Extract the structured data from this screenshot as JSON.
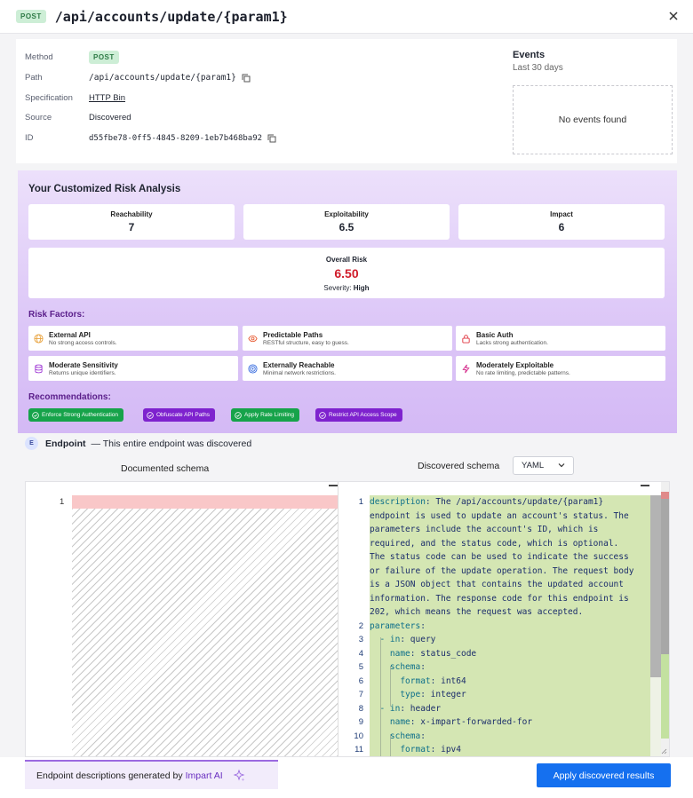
{
  "header": {
    "method_badge": "POST",
    "title": "/api/accounts/update/{param1}"
  },
  "info": {
    "method_label": "Method",
    "method_value": "POST",
    "path_label": "Path",
    "path_value": "/api/accounts/update/{param1}",
    "spec_label": "Specification",
    "spec_value": "HTTP Bin",
    "source_label": "Source",
    "source_value": "Discovered",
    "id_label": "ID",
    "id_value": "d55fbe78-0ff5-4845-8209-1eb7b468ba92"
  },
  "events": {
    "title": "Events",
    "subtitle": "Last 30 days",
    "empty": "No events found"
  },
  "risk": {
    "title": "Your Customized Risk Analysis",
    "metrics": [
      {
        "label": "Reachability",
        "value": "7"
      },
      {
        "label": "Exploitability",
        "value": "6.5"
      },
      {
        "label": "Impact",
        "value": "6"
      }
    ],
    "overall_label": "Overall Risk",
    "overall_value": "6.50",
    "severity_label": "Severity:",
    "severity_value": "High",
    "factors_title": "Risk Factors:",
    "factors": [
      {
        "name": "External API",
        "desc": "No strong access controls.",
        "icon": "globe-icon",
        "color": "#e8a13a"
      },
      {
        "name": "Predictable Paths",
        "desc": "RESTful structure, easy to guess.",
        "icon": "eye-icon",
        "color": "#e8613a"
      },
      {
        "name": "Basic Auth",
        "desc": "Lacks strong authentication.",
        "icon": "lock-icon",
        "color": "#e0353f"
      },
      {
        "name": "Moderate Sensitivity",
        "desc": "Returns unique identifiers.",
        "icon": "database-icon",
        "color": "#a23fd6"
      },
      {
        "name": "Externally Reachable",
        "desc": "Minimal network restrictions.",
        "icon": "target-icon",
        "color": "#3b6fe0"
      },
      {
        "name": "Moderately Exploitable",
        "desc": "No rate limiting, predictable patterns.",
        "icon": "lightning-icon",
        "color": "#d6308e"
      }
    ],
    "recs_title": "Recommendations:",
    "recs": [
      {
        "label": "Enforce Strong Authentication",
        "color": "#16a34a"
      },
      {
        "label": "Obfuscate API Paths",
        "color": "#7e22ce"
      },
      {
        "label": "Apply Rate Limiting",
        "color": "#16a34a"
      },
      {
        "label": "Restrict API Access Scope",
        "color": "#7e22ce"
      }
    ]
  },
  "endpoint": {
    "badge": "E",
    "title": "Endpoint",
    "note": "— This entire endpoint was discovered"
  },
  "schema": {
    "documented_title": "Documented schema",
    "discovered_title": "Discovered schema",
    "format": "YAML",
    "left_line": "1",
    "lines": [
      {
        "n": "1",
        "k": "description",
        "v": " The /api/accounts/update/{param1}",
        "indent": 0
      },
      {
        "n": "",
        "k": "",
        "v": "endpoint is used to update an account's status. The",
        "indent": 0
      },
      {
        "n": "",
        "k": "",
        "v": "parameters include the account's ID, which is",
        "indent": 0
      },
      {
        "n": "",
        "k": "",
        "v": "required, and the status code, which is optional.",
        "indent": 0
      },
      {
        "n": "",
        "k": "",
        "v": "The status code can be used to indicate the success",
        "indent": 0
      },
      {
        "n": "",
        "k": "",
        "v": "or failure of the update operation. The request body",
        "indent": 0
      },
      {
        "n": "",
        "k": "",
        "v": "is a JSON object that contains the updated account",
        "indent": 0
      },
      {
        "n": "",
        "k": "",
        "v": "information. The response code for this endpoint is",
        "indent": 0
      },
      {
        "n": "",
        "k": "",
        "v": "202, which means the request was accepted.",
        "indent": 0
      },
      {
        "n": "2",
        "k": "parameters",
        "v": "",
        "indent": 0
      },
      {
        "n": "3",
        "k": "- in",
        "v": " query",
        "indent": 2
      },
      {
        "n": "4",
        "k": "name",
        "v": " status_code",
        "indent": 4
      },
      {
        "n": "5",
        "k": "schema",
        "v": "",
        "indent": 4
      },
      {
        "n": "6",
        "k": "format",
        "v": " int64",
        "indent": 6
      },
      {
        "n": "7",
        "k": "type",
        "v": " integer",
        "indent": 6
      },
      {
        "n": "8",
        "k": "- in",
        "v": " header",
        "indent": 2
      },
      {
        "n": "9",
        "k": "name",
        "v": " x-impart-forwarded-for",
        "indent": 4
      },
      {
        "n": "10",
        "k": "schema",
        "v": "",
        "indent": 4
      },
      {
        "n": "11",
        "k": "format",
        "v": " ipv4",
        "indent": 6
      }
    ]
  },
  "footer": {
    "ai_note": "Endpoint descriptions generated by",
    "ai_brand": "Impart AI",
    "apply_label": "Apply discovered results",
    "accent": "#1570ef"
  }
}
